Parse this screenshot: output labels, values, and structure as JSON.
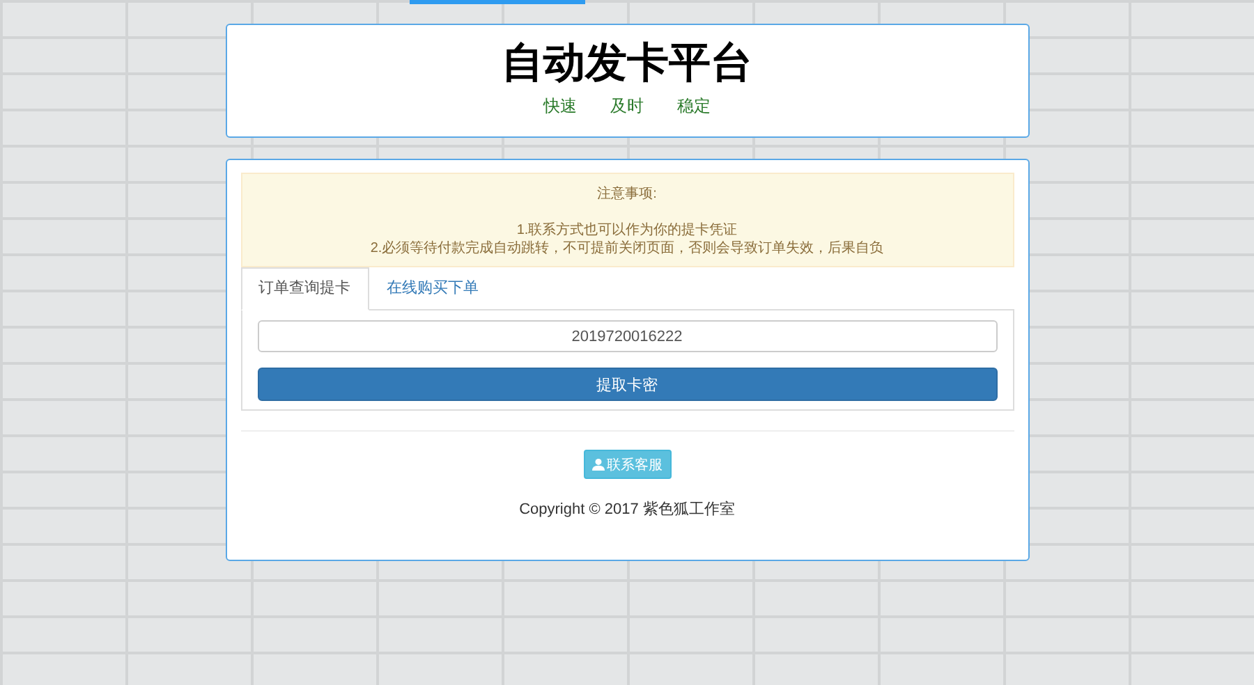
{
  "header": {
    "title": "自动发卡平台",
    "subtitle": "快速　　及时　　稳定"
  },
  "notice": {
    "heading": "注意事项:",
    "lines": [
      "1.联系方式也可以作为你的提卡凭证",
      "2.必须等待付款完成自动跳转，不可提前关闭页面，否则会导致订单失效，后果自负"
    ]
  },
  "tabs": [
    {
      "label": "订单查询提卡",
      "selected": true
    },
    {
      "label": "在线购买下单",
      "selected": false
    }
  ],
  "order_field": {
    "value": "2019720016222"
  },
  "submit_button": "提取卡密",
  "contact_button": "联系客服",
  "copyright": "Copyright © 2017 紫色狐工作室"
}
